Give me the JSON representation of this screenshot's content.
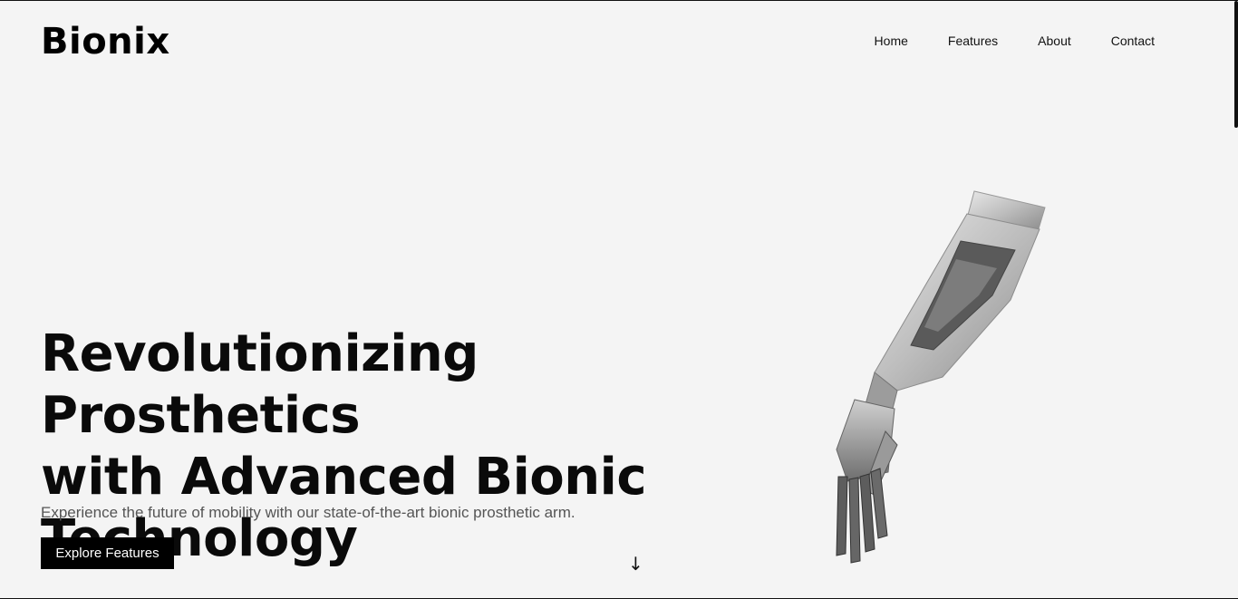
{
  "header": {
    "logo": "Bionix",
    "nav": [
      "Home",
      "Features",
      "About",
      "Contact"
    ]
  },
  "hero": {
    "title_lines": [
      "Revolutionizing Prosthetics",
      "with Advanced Bionic",
      "Technology"
    ],
    "subtitle": "Experience the future of mobility with our state-of-the-art bionic prosthetic arm.",
    "cta_label": "Explore Features",
    "scroll_glyph": "↓"
  },
  "colors": {
    "background": "#f4f4f4",
    "text": "#0a0a0a",
    "button_bg": "#000000",
    "button_text": "#ffffff",
    "subtitle": "#555555"
  }
}
